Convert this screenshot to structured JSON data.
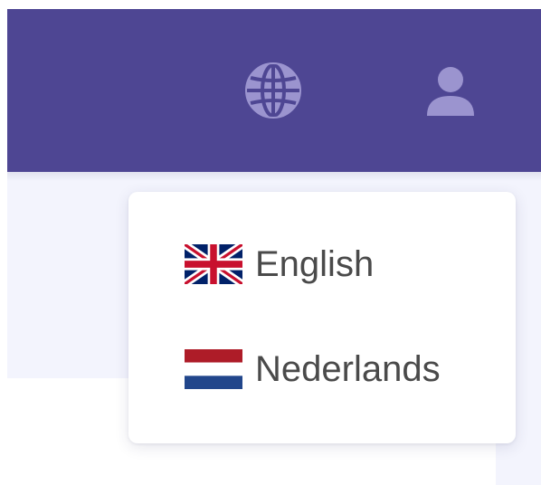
{
  "header": {
    "background_color": "#4e4693",
    "icon_color": "#9b94cf",
    "globe_icon": "globe-icon",
    "user_icon": "user-icon"
  },
  "language_menu": {
    "items": [
      {
        "label": "English",
        "flag": "uk-flag-icon"
      },
      {
        "label": "Nederlands",
        "flag": "netherlands-flag-icon"
      }
    ]
  }
}
